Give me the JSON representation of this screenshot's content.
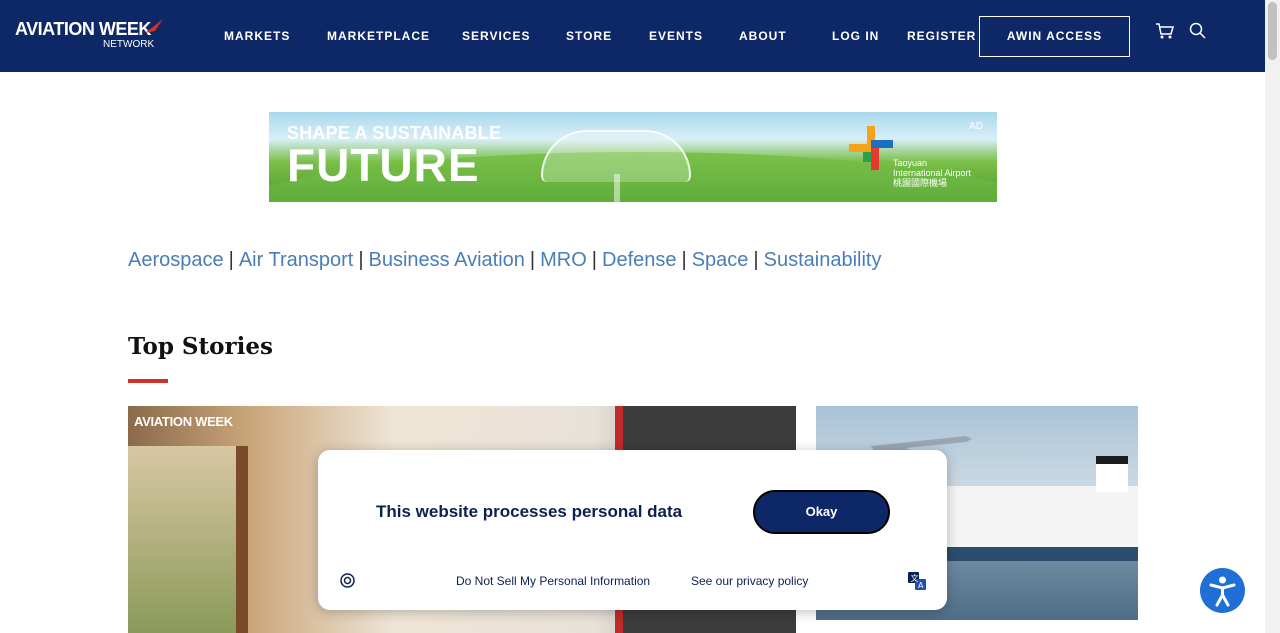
{
  "header": {
    "logo_main": "AVIATION WEEK",
    "logo_sub": "NETWORK",
    "nav": [
      "MARKETS",
      "MARKETPLACE",
      "SERVICES",
      "STORE",
      "EVENTS",
      "ABOUT",
      "LOG IN",
      "REGISTER"
    ],
    "awin_access": "AWIN ACCESS",
    "icons": [
      "cart-icon",
      "search-icon"
    ]
  },
  "ad": {
    "headline_small": "SHAPE A SUSTAINABLE",
    "headline_big": "FUTURE",
    "label": "AD",
    "sponsor_line1": "Taoyuan",
    "sponsor_line2": "International Airport",
    "sponsor_line3": "桃園國際機場"
  },
  "categories": [
    "Aerospace",
    "Air Transport",
    "Business Aviation",
    "MRO",
    "Defense",
    "Space",
    "Sustainability"
  ],
  "top_stories": {
    "title": "Top Stories",
    "main_image_watermark": "AVIATION WEEK"
  },
  "consent": {
    "message": "This website processes personal data",
    "okay": "Okay",
    "do_not_sell": "Do Not Sell My Personal Information",
    "privacy": "See our privacy policy"
  },
  "colors": {
    "header_bg": "#0e2766",
    "link": "#4a7db8",
    "accent_red": "#d0312d"
  }
}
